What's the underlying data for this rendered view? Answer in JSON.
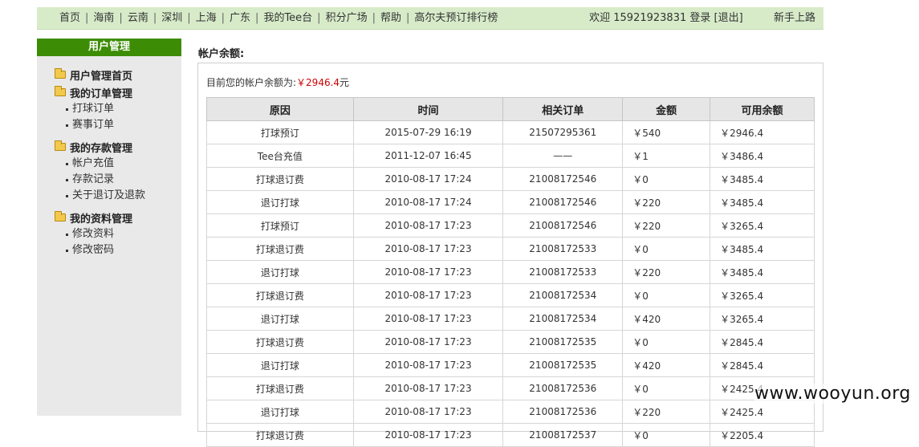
{
  "nav": {
    "links": [
      "首页",
      "海南",
      "云南",
      "深圳",
      "上海",
      "广东",
      "我的Tee台",
      "积分广场",
      "帮助",
      "高尔夫预订排行榜"
    ],
    "welcome": "欢迎 15921923831",
    "login": "登录",
    "logout": "[退出]",
    "newbie": "新手上路"
  },
  "sidebar": {
    "title": "用户管理",
    "groups": [
      {
        "head": "用户管理首页",
        "items": []
      },
      {
        "head": "我的订单管理",
        "items": [
          "打球订单",
          "赛事订单"
        ]
      },
      {
        "head": "我的存款管理",
        "items": [
          "帐户充值",
          "存款记录",
          "关于退订及退款"
        ]
      },
      {
        "head": "我的资料管理",
        "items": [
          "修改资料",
          "修改密码"
        ]
      }
    ]
  },
  "main": {
    "title": "帐户余额:",
    "balance_prefix": "目前您的帐户余额为:",
    "balance_amount": "￥2946.4",
    "balance_unit": "元"
  },
  "table": {
    "headers": [
      "原因",
      "时间",
      "相关订单",
      "金额",
      "可用余额"
    ],
    "rows": [
      [
        "打球预订",
        "2015-07-29 16:19",
        "21507295361",
        "￥540",
        "￥2946.4"
      ],
      [
        "Tee台充值",
        "2011-12-07 16:45",
        "——",
        "￥1",
        "￥3486.4"
      ],
      [
        "打球退订费",
        "2010-08-17 17:24",
        "21008172546",
        "￥0",
        "￥3485.4"
      ],
      [
        "退订打球",
        "2010-08-17 17:24",
        "21008172546",
        "￥220",
        "￥3485.4"
      ],
      [
        "打球预订",
        "2010-08-17 17:23",
        "21008172546",
        "￥220",
        "￥3265.4"
      ],
      [
        "打球退订费",
        "2010-08-17 17:23",
        "21008172533",
        "￥0",
        "￥3485.4"
      ],
      [
        "退订打球",
        "2010-08-17 17:23",
        "21008172533",
        "￥220",
        "￥3485.4"
      ],
      [
        "打球退订费",
        "2010-08-17 17:23",
        "21008172534",
        "￥0",
        "￥3265.4"
      ],
      [
        "退订打球",
        "2010-08-17 17:23",
        "21008172534",
        "￥420",
        "￥3265.4"
      ],
      [
        "打球退订费",
        "2010-08-17 17:23",
        "21008172535",
        "￥0",
        "￥2845.4"
      ],
      [
        "退订打球",
        "2010-08-17 17:23",
        "21008172535",
        "￥420",
        "￥2845.4"
      ],
      [
        "打球退订费",
        "2010-08-17 17:23",
        "21008172536",
        "￥0",
        "￥2425.4"
      ],
      [
        "退订打球",
        "2010-08-17 17:23",
        "21008172536",
        "￥220",
        "￥2425.4"
      ],
      [
        "打球退订费",
        "2010-08-17 17:23",
        "21008172537",
        "￥0",
        "￥2205.4"
      ]
    ]
  },
  "watermark": "www.wooyun.org",
  "colors": {
    "nav_bg": "#d7ebc9",
    "sidebar_title_bg": "#3c8d05",
    "sidebar_bg": "#e9e9e9",
    "balance_red": "#cc0000",
    "table_header_bg": "#e6e6e6"
  }
}
